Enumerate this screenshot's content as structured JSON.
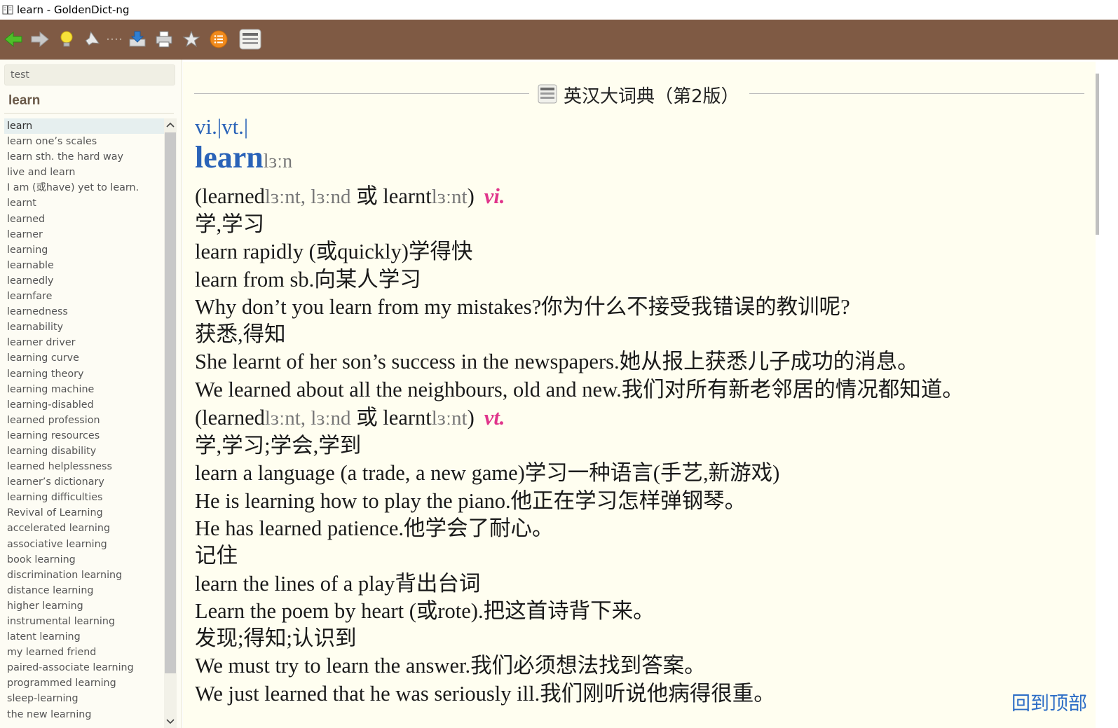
{
  "window": {
    "title": "learn - GoldenDict-ng"
  },
  "colors": {
    "toolbar_bg": "#7f5a44",
    "headword": "#2a63b8",
    "pos_tag": "#e0348b",
    "link": "#2c6dc6"
  },
  "toolbar": {
    "buttons": [
      {
        "name": "back-button",
        "icon": "arrow-left-icon"
      },
      {
        "name": "forward-button",
        "icon": "arrow-right-icon"
      },
      {
        "name": "scan-popup-button",
        "icon": "lightbulb-icon"
      },
      {
        "name": "pronounce-button",
        "icon": "speaker-icon"
      },
      {
        "name": "save-article-button",
        "icon": "save-icon"
      },
      {
        "name": "print-button",
        "icon": "printer-icon"
      },
      {
        "name": "favorites-button",
        "icon": "star-icon"
      },
      {
        "name": "history-button",
        "icon": "list-icon"
      },
      {
        "name": "dictionary-button",
        "icon": "dictionary-icon"
      }
    ]
  },
  "search": {
    "value": "test"
  },
  "current_word": "learn",
  "wordlist": [
    "learn",
    "learn one’s scales",
    "learn sth. the hard way",
    "live and learn",
    "I am (或have) yet to learn.",
    "learnt",
    "learned",
    "learner",
    "learning",
    "learnable",
    "learnedly",
    "learnfare",
    "learnedness",
    "learnability",
    "learner driver",
    "learning curve",
    "learning theory",
    "learning machine",
    "learning-disabled",
    "learned profession",
    "learning resources",
    "learning disability",
    "learned helplessness",
    "learner’s dictionary",
    "learning difficulties",
    "Revival of Learning",
    "accelerated learning",
    "associative learning",
    "book learning",
    "discrimination learning",
    "distance learning",
    "higher learning",
    "instrumental learning",
    "latent learning",
    "my learned friend",
    "paired-associate learning",
    "programmed learning",
    "sleep-learning",
    "the new learning"
  ],
  "article": {
    "dict_name": "英汉大词典（第2版）",
    "pos_line": "vi.|vt.|",
    "headword": "learn",
    "phonetic": "lɜːn",
    "vi": {
      "infl_open": "(learned",
      "infl_p1": "lɜːnt, lɜːnd",
      "infl_or": " 或 learnt",
      "infl_p2": "lɜːnt",
      "infl_close": ")",
      "pos": "vi.",
      "lines": [
        "学,学习",
        "learn rapidly (或quickly)学得快",
        "learn from sb.向某人学习",
        "Why don’t you learn from my mistakes?你为什么不接受我错误的教训呢?",
        "获悉,得知",
        "She learnt of her son’s success in the newspapers.她从报上获悉儿子成功的消息。",
        "We learned about all the neighbours, old and new.我们对所有新老邻居的情况都知道。"
      ]
    },
    "vt": {
      "infl_open": "(learned",
      "infl_p1": "lɜːnt, lɜːnd",
      "infl_or": " 或 learnt",
      "infl_p2": "lɜːnt",
      "infl_close": ")",
      "pos": "vt.",
      "lines": [
        "学,学习;学会,学到",
        "learn a language (a trade, a new game)学习一种语言(手艺,新游戏)",
        "He is learning how to play the piano.他正在学习怎样弹钢琴。",
        "He has learned patience.他学会了耐心。",
        "记住",
        "learn the lines of a play背出台词",
        "Learn the poem by heart (或rote).把这首诗背下来。",
        "发现;得知;认识到",
        "We must try to learn the answer.我们必须想法找到答案。",
        "We just learned that he was seriously ill.我们刚听说他病得很重。"
      ]
    }
  },
  "back_to_top": "回到顶部"
}
